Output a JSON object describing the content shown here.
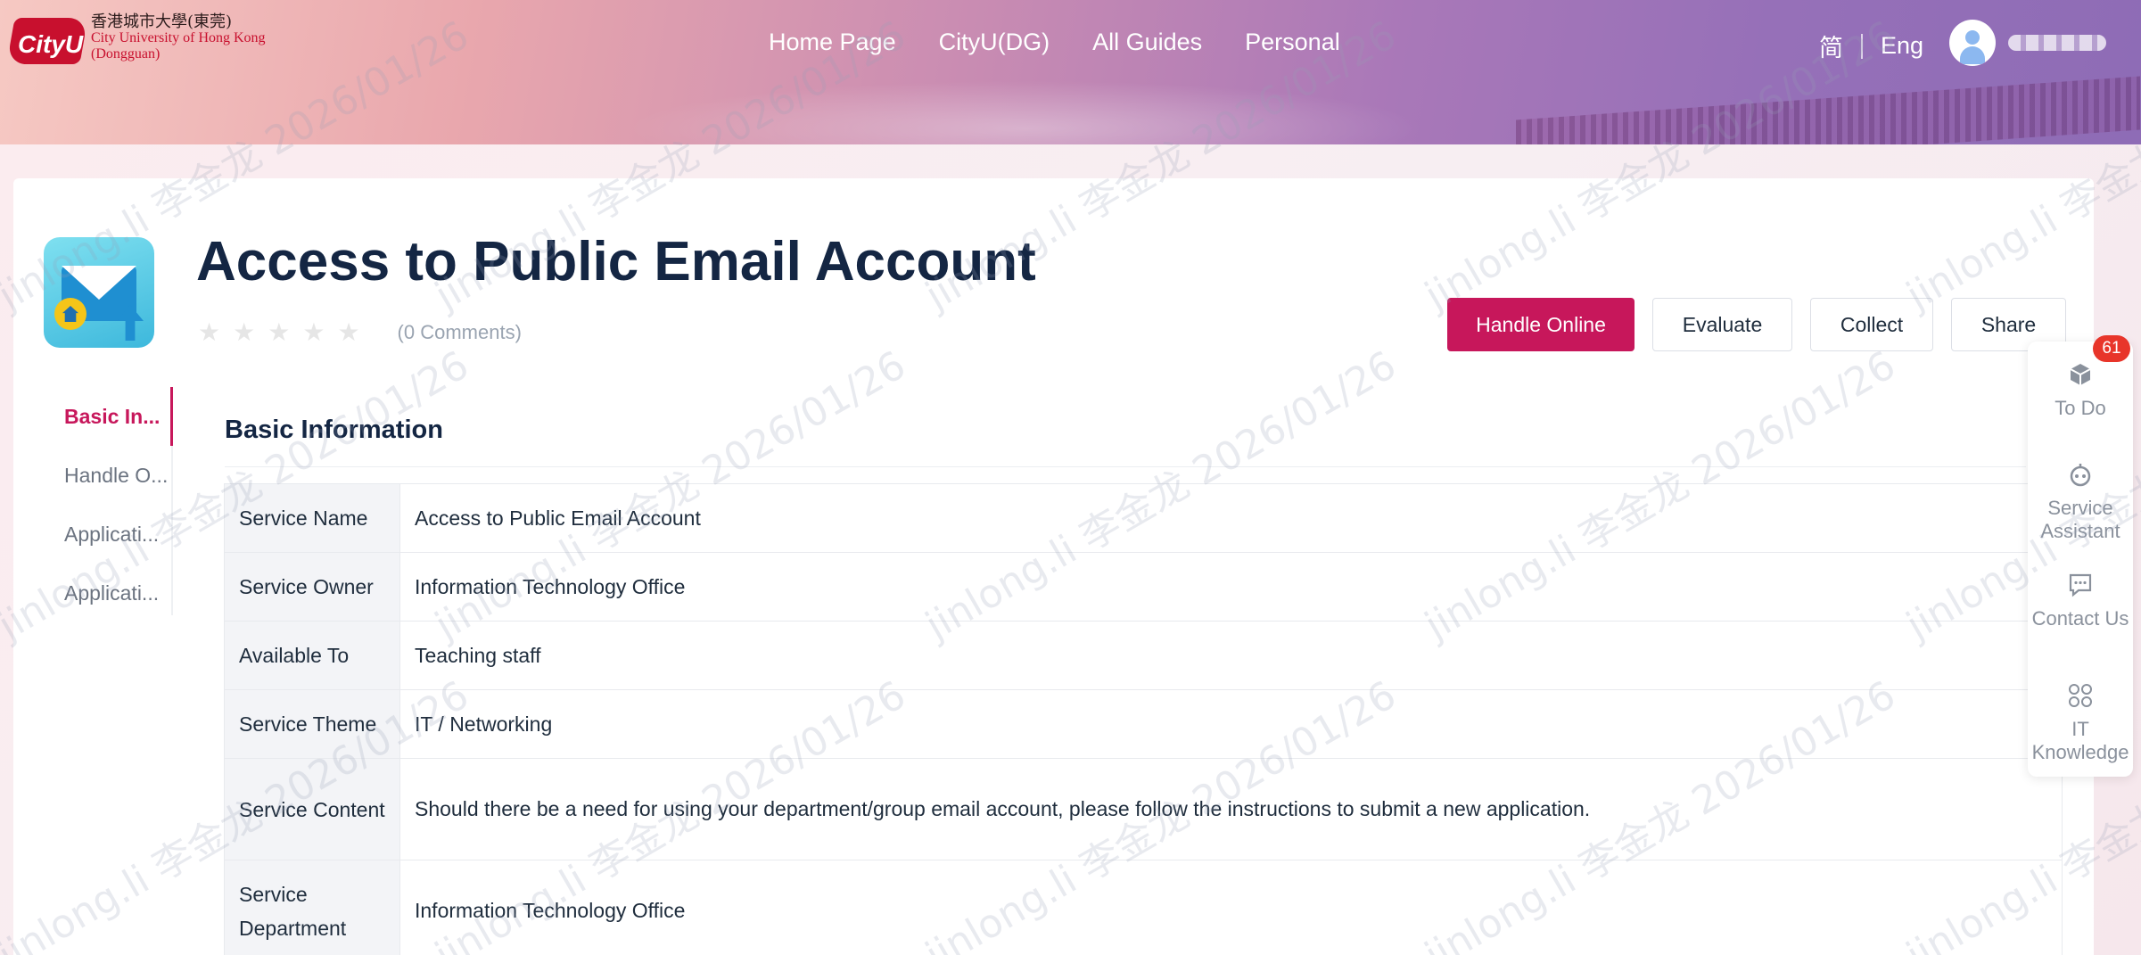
{
  "header": {
    "logo": {
      "badge_text": "CityU",
      "zh": "香港城市大學(東莞)",
      "en_line1": "City University of Hong Kong",
      "en_line2": "(Dongguan)"
    },
    "nav": [
      "Home Page",
      "CityU(DG)",
      "All Guides",
      "Personal"
    ],
    "lang": {
      "zh": "简",
      "en": "Eng"
    }
  },
  "service": {
    "title": "Access to Public Email Account",
    "comments": "(0 Comments)",
    "rating": 0,
    "stars_total": 5,
    "actions": {
      "handle": "Handle Online",
      "evaluate": "Evaluate",
      "collect": "Collect",
      "share": "Share"
    }
  },
  "side_nav": [
    "Basic In...",
    "Handle O...",
    "Applicati...",
    "Applicati..."
  ],
  "section": {
    "title": "Basic Information"
  },
  "info_rows": [
    {
      "key": "Service Name",
      "value": "Access to Public Email Account"
    },
    {
      "key": "Service Owner",
      "value": "Information Technology Office"
    },
    {
      "key": "Available To",
      "value": "Teaching staff"
    },
    {
      "key": "Service Theme",
      "value": "IT / Networking"
    },
    {
      "key": "Service Content",
      "value": "Should there be a need for using your department/group email account, please follow the instructions to submit a new application."
    },
    {
      "key": "Service Department",
      "value": "Information Technology Office"
    }
  ],
  "float_bar": {
    "badge": "61",
    "items": [
      "To Do",
      "Service Assistant",
      "Contact Us",
      "IT Knowledge"
    ]
  },
  "watermark": "jinlong.li 李金龙 2026/01/26",
  "colors": {
    "accent": "#c7175b",
    "title": "#142643",
    "badge": "#e8352a"
  }
}
